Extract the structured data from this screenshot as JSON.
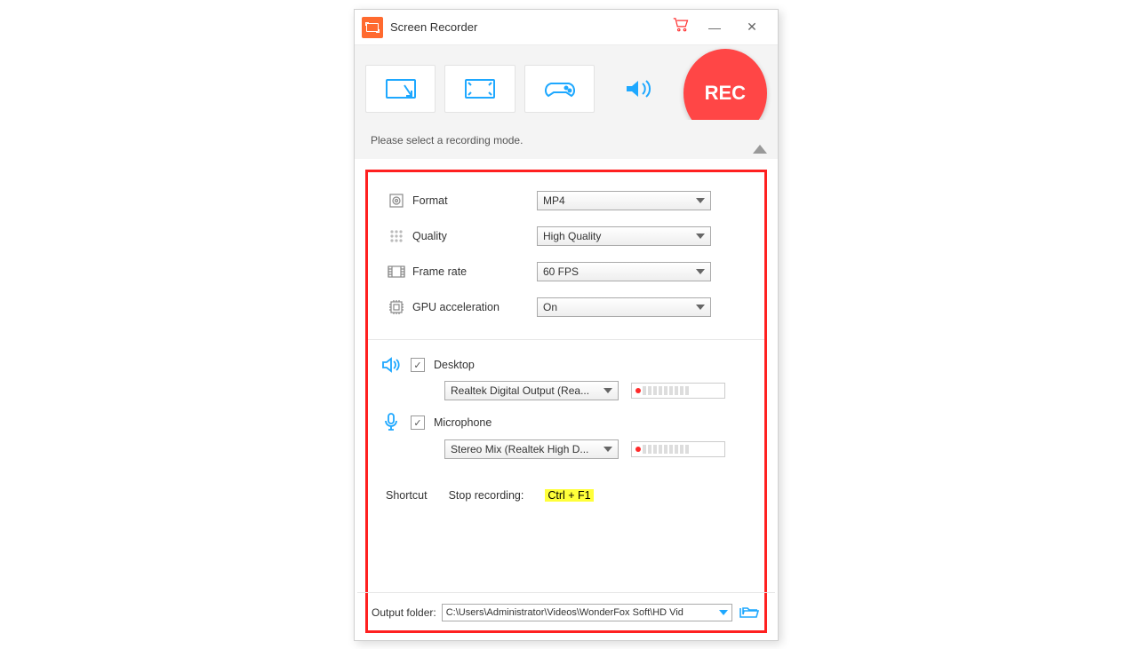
{
  "title": "Screen Recorder",
  "rec_label": "REC",
  "hint": "Please select a recording mode.",
  "settings": {
    "format": {
      "label": "Format",
      "value": "MP4"
    },
    "quality": {
      "label": "Quality",
      "value": "High Quality"
    },
    "framerate": {
      "label": "Frame rate",
      "value": "60 FPS"
    },
    "gpu": {
      "label": "GPU acceleration",
      "value": "On"
    }
  },
  "audio": {
    "desktop": {
      "label": "Desktop",
      "device": "Realtek Digital Output (Rea..."
    },
    "mic": {
      "label": "Microphone",
      "device": "Stereo Mix (Realtek High D..."
    }
  },
  "shortcut": {
    "label": "Shortcut",
    "stop_label": "Stop recording:",
    "key": "Ctrl + F1"
  },
  "output": {
    "label": "Output folder:",
    "path": "C:\\Users\\Administrator\\Videos\\WonderFox Soft\\HD Vid"
  }
}
